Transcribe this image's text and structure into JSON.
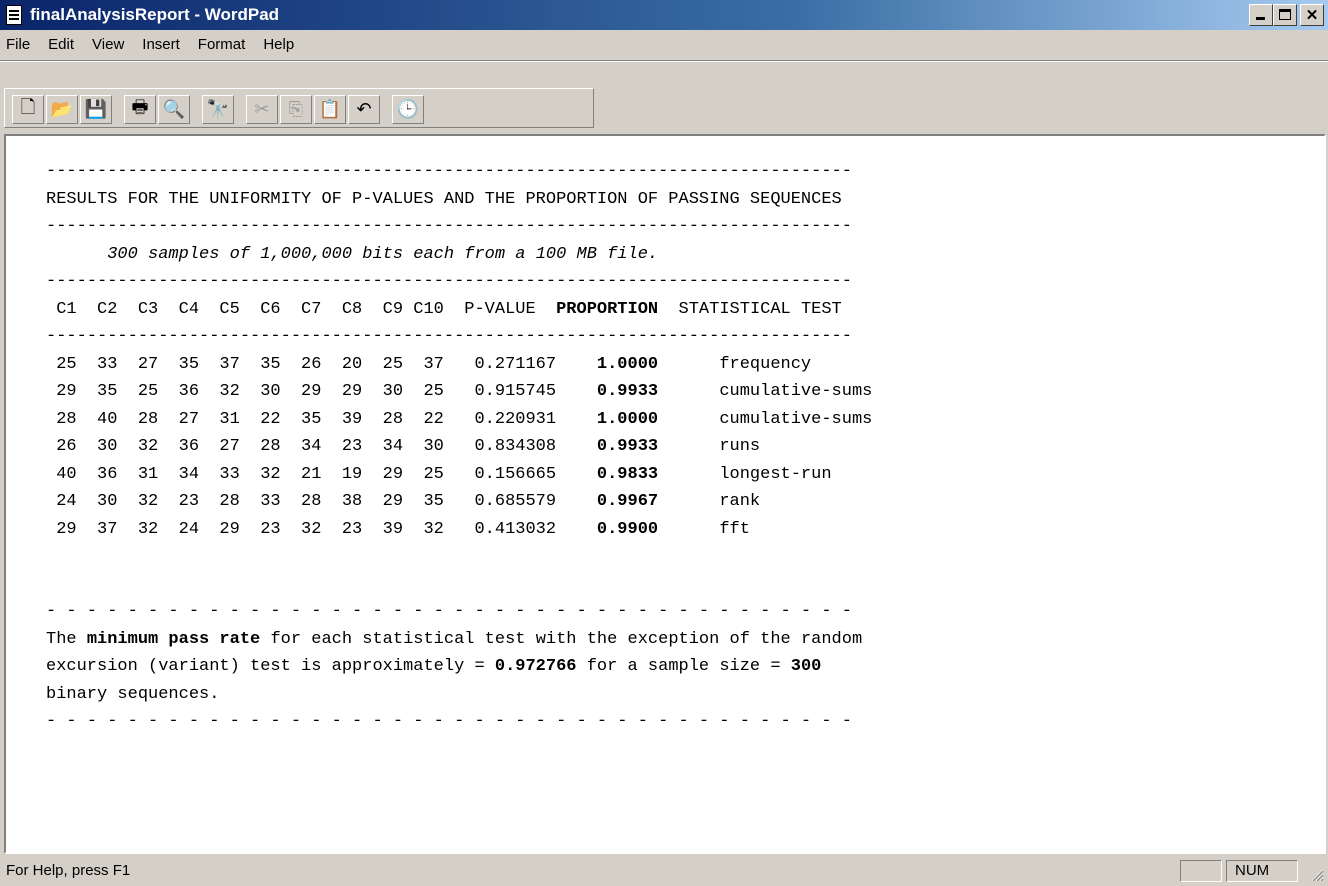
{
  "window": {
    "title": "finalAnalysisReport - WordPad"
  },
  "menu": {
    "items": [
      "File",
      "Edit",
      "View",
      "Insert",
      "Format",
      "Help"
    ]
  },
  "toolbar": {
    "buttons": [
      {
        "name": "new-document-icon",
        "glyph": "🗋"
      },
      {
        "name": "open-folder-icon",
        "glyph": "📂"
      },
      {
        "name": "save-disk-icon",
        "glyph": "💾"
      },
      {
        "name": "print-icon",
        "glyph": "🖶"
      },
      {
        "name": "print-preview-icon",
        "glyph": "🔍"
      },
      {
        "name": "find-binoculars-icon",
        "glyph": "🔭"
      },
      {
        "name": "cut-scissors-icon",
        "glyph": "✂"
      },
      {
        "name": "copy-icon",
        "glyph": "⎘"
      },
      {
        "name": "paste-icon",
        "glyph": "📋"
      },
      {
        "name": "undo-icon",
        "glyph": "↶"
      },
      {
        "name": "date-time-icon",
        "glyph": "🕒"
      }
    ]
  },
  "report": {
    "title": "RESULTS FOR THE UNIFORMITY OF P-VALUES AND THE PROPORTION OF PASSING SEQUENCES",
    "subtitle": "300 samples of 1,000,000 bits each from a 100 MB file.",
    "headers": {
      "c": [
        "C1",
        "C2",
        "C3",
        "C4",
        "C5",
        "C6",
        "C7",
        "C8",
        "C9",
        "C10"
      ],
      "pvalue": "P-VALUE",
      "proportion": "PROPORTION",
      "test": "STATISTICAL TEST"
    },
    "rows": [
      {
        "c": [
          "25",
          "33",
          "27",
          "35",
          "37",
          "35",
          "26",
          "20",
          "25",
          "37"
        ],
        "pvalue": "0.271167",
        "proportion": "1.0000",
        "test": "frequency"
      },
      {
        "c": [
          "29",
          "35",
          "25",
          "36",
          "32",
          "30",
          "29",
          "29",
          "30",
          "25"
        ],
        "pvalue": "0.915745",
        "proportion": "0.9933",
        "test": "cumulative-sums"
      },
      {
        "c": [
          "28",
          "40",
          "28",
          "27",
          "31",
          "22",
          "35",
          "39",
          "28",
          "22"
        ],
        "pvalue": "0.220931",
        "proportion": "1.0000",
        "test": "cumulative-sums"
      },
      {
        "c": [
          "26",
          "30",
          "32",
          "36",
          "27",
          "28",
          "34",
          "23",
          "34",
          "30"
        ],
        "pvalue": "0.834308",
        "proportion": "0.9933",
        "test": "runs"
      },
      {
        "c": [
          "40",
          "36",
          "31",
          "34",
          "33",
          "32",
          "21",
          "19",
          "29",
          "25"
        ],
        "pvalue": "0.156665",
        "proportion": "0.9833",
        "test": "longest-run"
      },
      {
        "c": [
          "24",
          "30",
          "32",
          "23",
          "28",
          "33",
          "28",
          "38",
          "29",
          "35"
        ],
        "pvalue": "0.685579",
        "proportion": "0.9967",
        "test": "rank"
      },
      {
        "c": [
          "29",
          "37",
          "32",
          "24",
          "29",
          "23",
          "32",
          "23",
          "39",
          "32"
        ],
        "pvalue": "0.413032",
        "proportion": "0.9900",
        "test": "fft"
      }
    ],
    "note": {
      "p1": "The ",
      "b1": "minimum pass rate",
      "p2": " for each statistical test with the exception of the random",
      "p3": "excursion (variant) test is approximately = ",
      "b2": "0.972766",
      "p4": " for a sample size = ",
      "b3": "300",
      "p5": "binary sequences."
    }
  },
  "status": {
    "help": "For Help, press F1",
    "num": "NUM"
  }
}
